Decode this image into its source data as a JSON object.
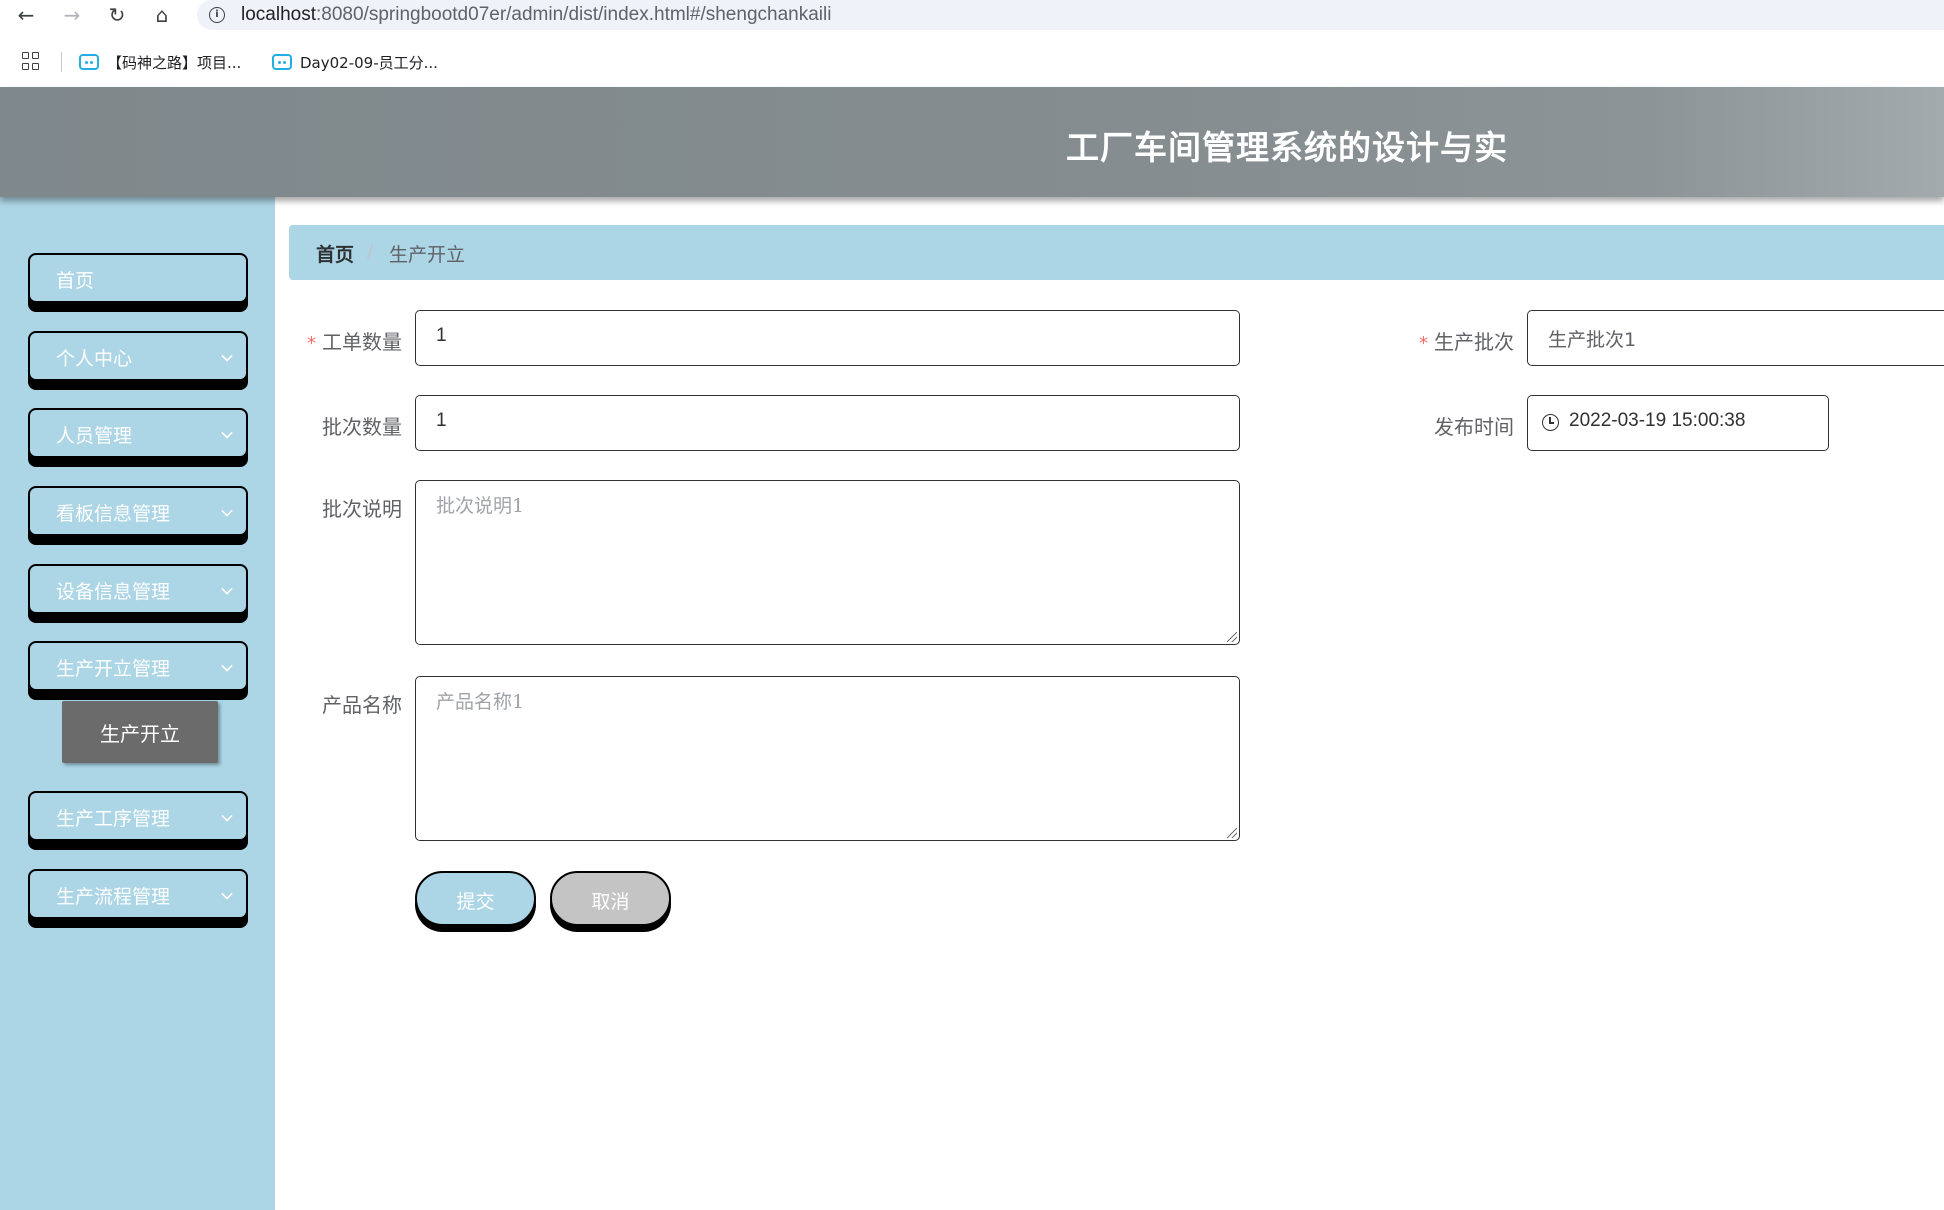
{
  "browser": {
    "url_host": "localhost",
    "url_rest": ":8080/springbootd07er/admin/dist/index.html#/shengchankaili",
    "bookmarks": [
      {
        "label": "【码神之路】项目..."
      },
      {
        "label": "Day02-09-员工分..."
      }
    ]
  },
  "header": {
    "title": "工厂车间管理系统的设计与实"
  },
  "sidebar": {
    "items": [
      {
        "label": "首页"
      },
      {
        "label": "个人中心"
      },
      {
        "label": "人员管理"
      },
      {
        "label": "看板信息管理"
      },
      {
        "label": "设备信息管理"
      },
      {
        "label": "生产开立管理"
      },
      {
        "label": "生产工序管理"
      },
      {
        "label": "生产流程管理"
      }
    ],
    "active_sub_item": {
      "label": "生产开立"
    }
  },
  "breadcrumb": {
    "home": "首页",
    "separator": "/",
    "current": "生产开立"
  },
  "form": {
    "required_mark": "*",
    "work_order_qty": {
      "label": "工单数量",
      "value": "1"
    },
    "batch": {
      "label": "生产批次",
      "value": "生产批次1"
    },
    "batch_qty": {
      "label": "批次数量",
      "value": "1"
    },
    "publish_time": {
      "label": "发布时间",
      "value": "2022-03-19 15:00:38"
    },
    "batch_desc": {
      "label": "批次说明",
      "placeholder": "批次说明1"
    },
    "product_name": {
      "label": "产品名称",
      "placeholder": "产品名称1"
    },
    "submit_label": "提交",
    "cancel_label": "取消"
  },
  "colors": {
    "sidebar_bg": "#acd5e6",
    "header_bg": "#858d90",
    "active_sub_bg": "#6b6b6b",
    "required": "#f56c6c"
  }
}
